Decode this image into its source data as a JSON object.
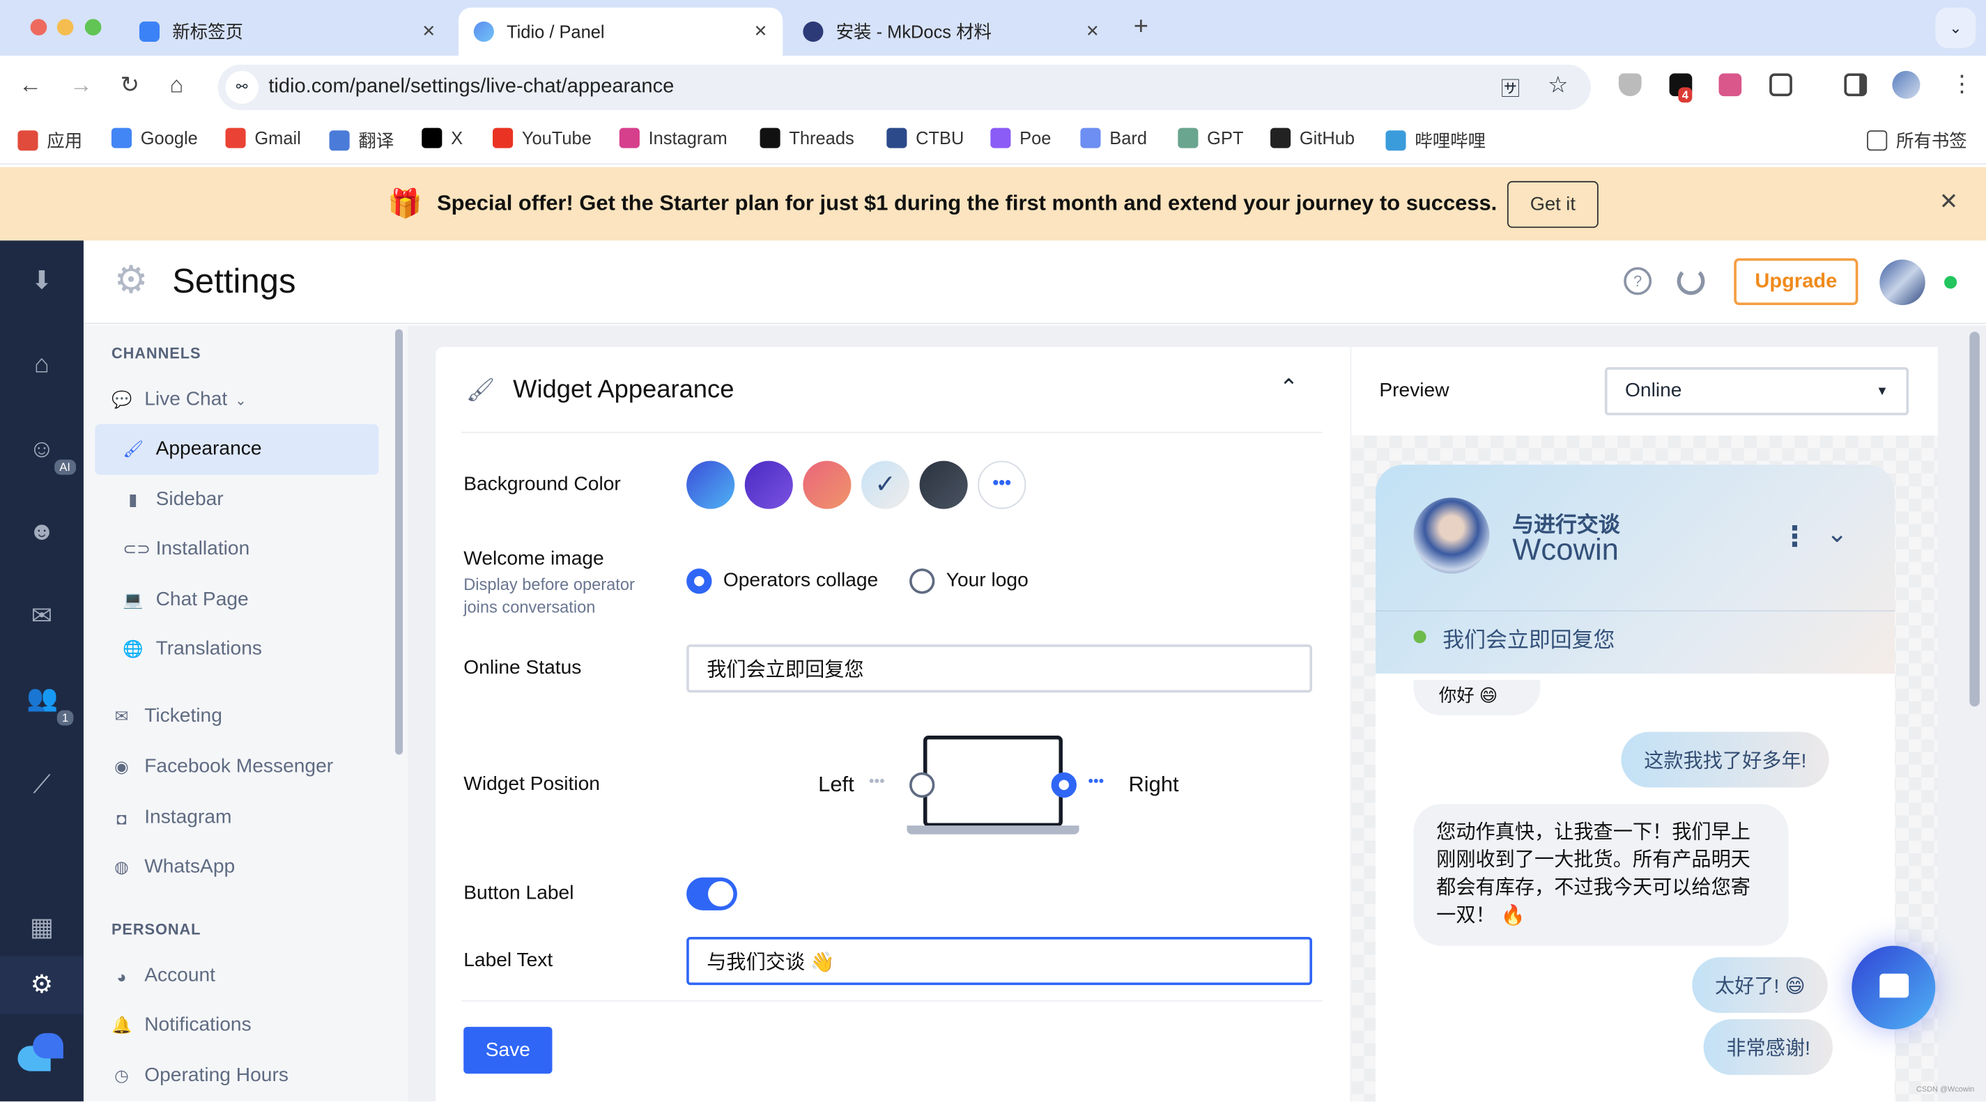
{
  "browser": {
    "tabs": [
      {
        "title": "新标签页",
        "active": false
      },
      {
        "title": "Tidio / Panel",
        "active": true
      },
      {
        "title": "安装 - MkDocs 材料",
        "active": false
      }
    ],
    "url": "tidio.com/panel/settings/live-chat/appearance",
    "extension_badge": "4",
    "bookmarks": [
      {
        "label": "应用",
        "icon": "apps-grid-icon"
      },
      {
        "label": "Google",
        "icon": "google-icon"
      },
      {
        "label": "Gmail",
        "icon": "gmail-icon"
      },
      {
        "label": "翻译",
        "icon": "translate-icon"
      },
      {
        "label": "X",
        "icon": "x-icon"
      },
      {
        "label": "YouTube",
        "icon": "youtube-icon"
      },
      {
        "label": "Instagram",
        "icon": "instagram-icon"
      },
      {
        "label": "Threads",
        "icon": "threads-icon"
      },
      {
        "label": "CTBU",
        "icon": "ctbu-icon"
      },
      {
        "label": "Poe",
        "icon": "poe-icon"
      },
      {
        "label": "Bard",
        "icon": "bard-icon"
      },
      {
        "label": "GPT",
        "icon": "gpt-icon"
      },
      {
        "label": "GitHub",
        "icon": "github-icon"
      },
      {
        "label": "哔哩哔哩",
        "icon": "bilibili-icon"
      }
    ],
    "all_bookmarks": "所有书签"
  },
  "promo": {
    "text": "Special offer! Get the Starter plan for just $1 during the first month and extend your journey to success.",
    "button": "Get it",
    "bg_color": "#fbe4bf"
  },
  "rail": {
    "ai_badge": "AI",
    "contacts_badge": "1"
  },
  "header": {
    "title": "Settings",
    "upgrade": "Upgrade",
    "status_color": "#22c55e"
  },
  "settings_nav": {
    "channels_heading": "CHANNELS",
    "live_chat": "Live Chat",
    "live_chat_items": [
      {
        "label": "Appearance",
        "icon": "brush-icon",
        "active": true
      },
      {
        "label": "Sidebar",
        "icon": "bookmark-icon"
      },
      {
        "label": "Installation",
        "icon": "link-icon"
      },
      {
        "label": "Chat Page",
        "icon": "laptop-icon"
      },
      {
        "label": "Translations",
        "icon": "globe-icon"
      }
    ],
    "channels": [
      {
        "label": "Ticketing",
        "icon": "envelope-icon"
      },
      {
        "label": "Facebook Messenger",
        "icon": "messenger-icon"
      },
      {
        "label": "Instagram",
        "icon": "instagram-icon"
      },
      {
        "label": "WhatsApp",
        "icon": "whatsapp-icon"
      }
    ],
    "personal_heading": "PERSONAL",
    "personal": [
      {
        "label": "Account",
        "icon": "account-icon"
      },
      {
        "label": "Notifications",
        "icon": "bell-icon"
      },
      {
        "label": "Operating Hours",
        "icon": "clock-icon"
      }
    ]
  },
  "widget_appearance": {
    "title": "Widget Appearance",
    "background_color_label": "Background Color",
    "swatches": [
      {
        "gradient": [
          "#3b4fd8",
          "#4fb3f5"
        ]
      },
      {
        "gradient": [
          "#4a2bc4",
          "#7a52e0"
        ]
      },
      {
        "gradient": [
          "#e9657a",
          "#f0956b"
        ]
      },
      {
        "gradient": [
          "#c7e3f6",
          "#eeeceb"
        ],
        "selected": true
      },
      {
        "gradient": [
          "#2b3340",
          "#4a5361"
        ]
      }
    ],
    "welcome_image_label": "Welcome image",
    "welcome_image_hint": "Display before operator joins conversation",
    "welcome_options": [
      {
        "label": "Operators collage",
        "selected": true
      },
      {
        "label": "Your logo",
        "selected": false
      }
    ],
    "online_status_label": "Online Status",
    "online_status_value": "我们会立即回复您",
    "widget_position_label": "Widget Position",
    "position_left": "Left",
    "position_right": "Right",
    "position_selected": "Right",
    "button_label_label": "Button Label",
    "button_label_enabled": true,
    "label_text_label": "Label Text",
    "label_text_value": "与我们交谈 👋",
    "save": "Save",
    "accent": "#2f66f6"
  },
  "preview": {
    "label": "Preview",
    "status_select": "Online",
    "widget": {
      "subtitle": "与进行交谈",
      "name": "Wcowin",
      "status": "我们会立即回复您",
      "messages": [
        {
          "from": "operator",
          "text": "你好 😄"
        },
        {
          "from": "visitor",
          "text": "这款我找了好多年!"
        },
        {
          "from": "operator",
          "text": "您动作真快，让我查一下！我们早上刚刚收到了一大批货。所有产品明天都会有库存，不过我今天可以给您寄一双！ 🔥"
        },
        {
          "from": "visitor",
          "text": "太好了! 😄"
        },
        {
          "from": "visitor",
          "text": "非常感谢!"
        }
      ]
    }
  },
  "watermark": "CSDN @Wcowin"
}
